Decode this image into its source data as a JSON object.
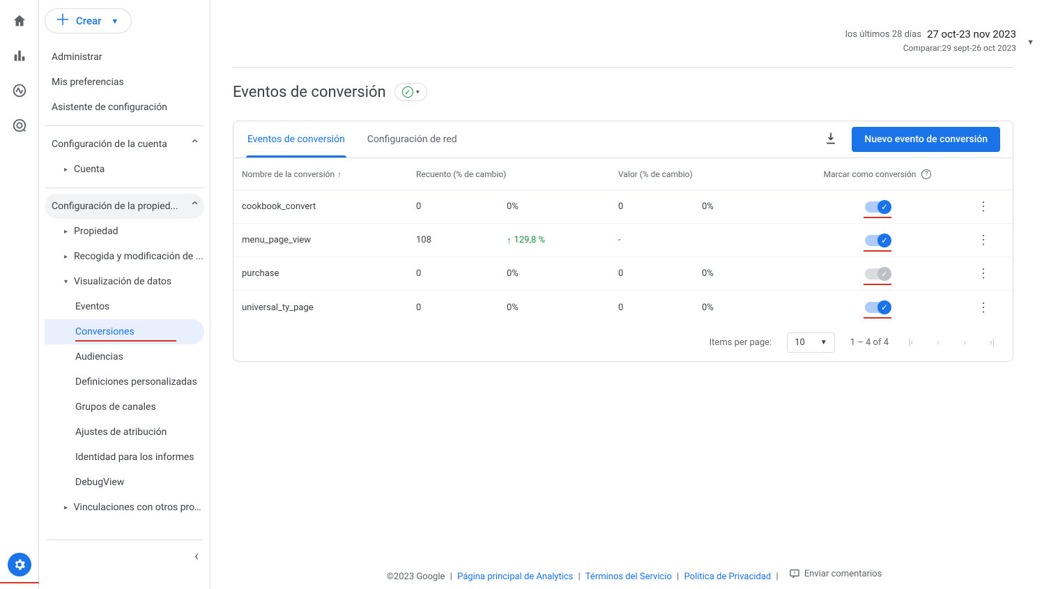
{
  "rail": {
    "icons": [
      "home",
      "reports",
      "explore",
      "advertising"
    ]
  },
  "sidebar": {
    "create_label": "Crear",
    "nav_simple": [
      "Administrar",
      "Mis preferencias",
      "Asistente de configuración"
    ],
    "section_account": {
      "label": "Configuración de la cuenta",
      "items": [
        "Cuenta"
      ]
    },
    "section_property": {
      "label": "Configuración de la propied...",
      "items": [
        {
          "label": "Propiedad",
          "expandable": true
        },
        {
          "label": "Recogida y modificación de ...",
          "expandable": true
        },
        {
          "label": "Visualización de datos",
          "expandable": true,
          "expanded": true,
          "children": [
            "Eventos",
            "Conversiones",
            "Audiencias",
            "Definiciones personalizadas",
            "Grupos de canales",
            "Ajustes de atribución",
            "Identidad para los informes",
            "DebugView"
          ],
          "active_child": "Conversiones"
        },
        {
          "label": "Vinculaciones con otros prod...",
          "expandable": true
        }
      ]
    }
  },
  "date_range": {
    "prefix": "los últimos 28 días",
    "range": "27 oct-23 nov 2023",
    "compare": "Comparar:29 sept-26 oct 2023"
  },
  "page": {
    "title": "Eventos de conversión"
  },
  "card": {
    "tabs": [
      "Eventos de conversión",
      "Configuración de red"
    ],
    "active_tab": 0,
    "new_button": "Nuevo evento de conversión",
    "columns": {
      "name": "Nombre de la conversión",
      "count": "Recuento (% de cambio)",
      "value": "Valor (% de cambio)",
      "mark": "Marcar como conversión"
    },
    "rows": [
      {
        "name": "cookbook_convert",
        "count": "0",
        "count_pct": "0%",
        "pct_up": false,
        "value": "0",
        "value_pct": "0%",
        "toggle": true
      },
      {
        "name": "menu_page_view",
        "count": "108",
        "count_pct": "129,8 %",
        "pct_up": true,
        "value": "-",
        "value_pct": "",
        "toggle": true
      },
      {
        "name": "purchase",
        "count": "0",
        "count_pct": "0%",
        "pct_up": false,
        "value": "0",
        "value_pct": "0%",
        "toggle": false
      },
      {
        "name": "universal_ty_page",
        "count": "0",
        "count_pct": "0%",
        "pct_up": false,
        "value": "0",
        "value_pct": "0%",
        "toggle": true
      }
    ],
    "pager": {
      "items_per_page_label": "Items per page:",
      "items_per_page": "10",
      "range_text": "1 – 4 of 4"
    }
  },
  "footer": {
    "copyright": "©2023 Google",
    "links": [
      "Página principal de Analytics",
      "Términos del Servicio",
      "Política de Privacidad"
    ],
    "feedback": "Enviar comentarios"
  }
}
